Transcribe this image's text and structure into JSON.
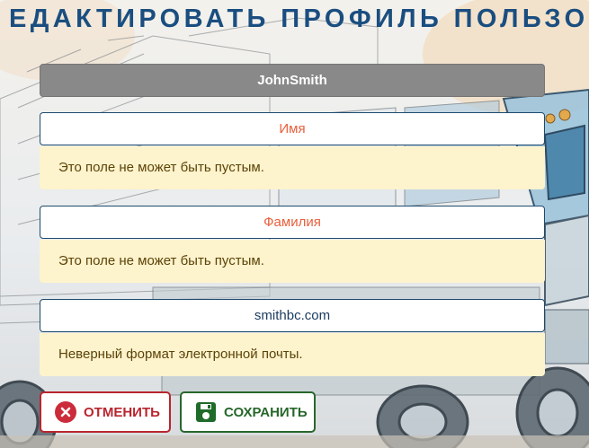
{
  "page": {
    "title": "ЕДАКТИРОВАТЬ ПРОФИЛЬ ПОЛЬЗОВАТЕЛЯ"
  },
  "form": {
    "username_value": "JohnSmith",
    "first_name_placeholder": "Имя",
    "last_name_placeholder": "Фамилия",
    "email_value": "smithbc.com",
    "errors": {
      "first_name": "Это поле не может быть пустым.",
      "last_name": "Это поле не может быть пустым.",
      "email": "Неверный формат электронной почты."
    }
  },
  "buttons": {
    "cancel_label": "ОТМЕНИТЬ",
    "cancel_icon": "close-circle-icon",
    "save_label": "СОХРАНИТЬ",
    "save_icon": "floppy-disk-icon"
  },
  "colors": {
    "title": "#1a4e80",
    "placeholder": "#e8603c",
    "error_background": "#fdf3cd",
    "cancel": "#b9252e",
    "save": "#27672b",
    "readonly_field": "#898989"
  }
}
